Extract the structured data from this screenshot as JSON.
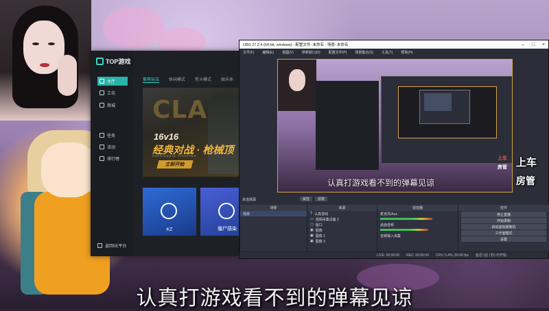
{
  "stream_overlay": {
    "badge_top": "上车",
    "badge_bottom": "房管",
    "subtitle": "认真打游戏看不到的弹幕见谅"
  },
  "top_app": {
    "logo_text": "TOP游戏",
    "sidebar": [
      {
        "label": "大厅",
        "icon": "home-icon",
        "active": true
      },
      {
        "label": "工坊",
        "icon": "workshop-icon"
      },
      {
        "label": "商城",
        "icon": "store-icon"
      },
      {
        "label": "任务",
        "icon": "task-icon"
      },
      {
        "label": "活动",
        "icon": "event-icon"
      },
      {
        "label": "排行榜",
        "icon": "ranking-icon"
      }
    ],
    "back_label": "返回5E平台",
    "tabs": [
      "推荐玩法",
      "休闲模式",
      "死斗模式",
      "娱乐休"
    ],
    "banner": {
      "big": "CLAS",
      "line1": "16v16",
      "line2": "经典对战 · 枪械顶",
      "small": "PASSIONATE FIGHTING",
      "button": "立即开始"
    },
    "cards": [
      {
        "label": "KZ",
        "color": "#2f6bd6"
      },
      {
        "label": "僵尸感染",
        "color": "#1f3f94"
      }
    ]
  },
  "obs": {
    "title": "OBS 27.2.4 (64-bit, windows) - 配置文件: 未命名 - 场景: 未命名",
    "menu": [
      "文件(F)",
      "编辑(E)",
      "视图(V)",
      "停靠窗口(D)",
      "配置文件(P)",
      "场景集合(S)",
      "工具(T)",
      "帮助(H)"
    ],
    "preview_subtitle": "认真打游戏看不到的弹幕见谅",
    "preview_badge_top": "上车",
    "preview_badge_bottom": "房管",
    "scene_label": "未选择源",
    "btn_props": "属性",
    "btn_filters": "滤镜",
    "panels": {
      "scenes": {
        "title": "场景",
        "items": [
          "场景"
        ]
      },
      "sources": {
        "title": "来源",
        "items": [
          "认真游戏",
          "视频采集设备 2",
          "窗口",
          "图像",
          "图像 2",
          "图像 3"
        ]
      },
      "mixer": {
        "title": "混音器",
        "items": [
          "麦克风/Aux",
          "桌面音频",
          "音频输入采集"
        ]
      },
      "controls": {
        "title": "控件",
        "items": [
          "停止直播",
          "开始录制",
          "启动虚拟摄像机",
          "工作室模式",
          "设置",
          "退出"
        ]
      }
    },
    "status": [
      "LIVE: 00:00:00",
      "REC: 00:00:00",
      "CPU: 5.4%, 60.00 fps",
      "延迟 (估 | 秒) 约开始"
    ]
  }
}
